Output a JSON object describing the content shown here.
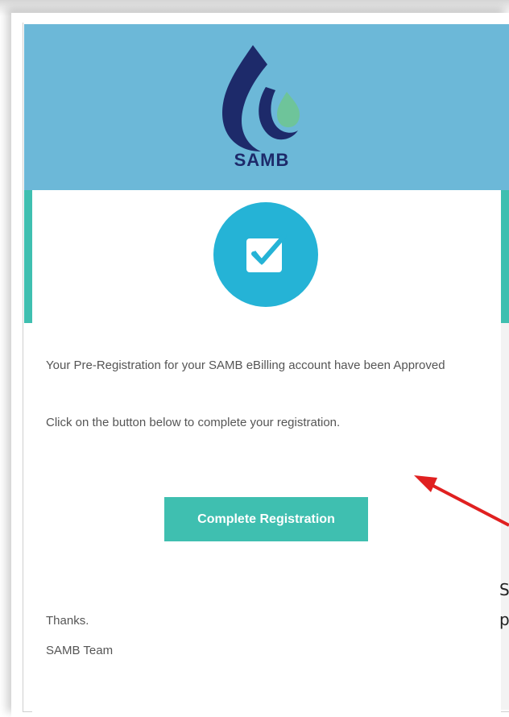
{
  "colors": {
    "header_bg": "#6cb8d8",
    "accent_teal": "#3fbfb0",
    "check_circle": "#25b3d6",
    "logo_navy": "#1d2a6a",
    "logo_green": "#6ec49a",
    "annotation_arrow": "#e02020"
  },
  "logo": {
    "text": "SAMB",
    "icon": "water-drop-logo-icon"
  },
  "status_icon": "checkbox-check-icon",
  "message": {
    "approved": "Your Pre-Registration for your SAMB eBilling account have been Approved",
    "instruction": "Click on the button below to complete your registration."
  },
  "button": {
    "label": "Complete Registration"
  },
  "signature": {
    "thanks": "Thanks.",
    "team": "SAMB Team"
  },
  "overlay": {
    "line1": "S",
    "line2": "p"
  }
}
